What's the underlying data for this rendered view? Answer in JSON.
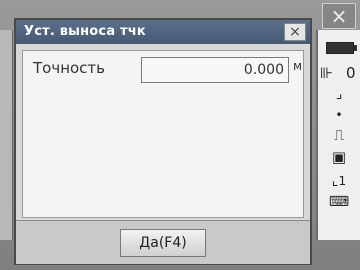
{
  "dialog": {
    "title": "Уст. выноса тчк",
    "close_glyph": "×",
    "field_label": "Точность",
    "field_value": "0.000",
    "field_unit": "м",
    "ok_label": "Да(F4)"
  },
  "background": {
    "close_glyph": "×"
  },
  "status_panel": {
    "zero": "0",
    "mode": "1"
  }
}
